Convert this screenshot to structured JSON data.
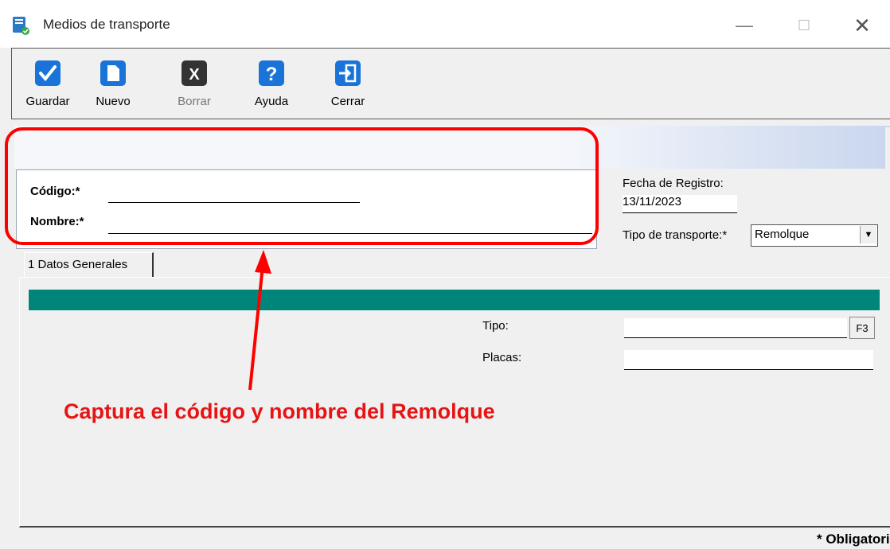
{
  "window": {
    "title": "Medios de transporte",
    "controls": {
      "minimize": "—",
      "maximize": "☐",
      "close": "✕"
    }
  },
  "toolbar": {
    "buttons": [
      {
        "label": "Guardar",
        "icon": "check-icon",
        "enabled": true
      },
      {
        "label": "Nuevo",
        "icon": "new-document-icon",
        "enabled": true
      },
      {
        "label": "Borrar",
        "icon": "delete-x-icon",
        "enabled": false
      },
      {
        "label": "Ayuda",
        "icon": "help-icon",
        "enabled": true
      },
      {
        "label": "Cerrar",
        "icon": "exit-door-icon",
        "enabled": true
      }
    ]
  },
  "form": {
    "codigo_label": "Código:*",
    "codigo_value": "",
    "nombre_label": "Nombre:*",
    "nombre_value": "",
    "fecha_label": "Fecha de Registro:",
    "fecha_value": "13/11/2023",
    "tipo_transporte_label": "Tipo de transporte:*",
    "tipo_transporte_value": "Remolque"
  },
  "tabs": [
    {
      "label": "1 Datos Generales",
      "active": true
    }
  ],
  "datos_generales": {
    "tipo_label": "Tipo:",
    "tipo_value": "",
    "f3_label": "F3",
    "placas_label": "Placas:",
    "placas_value": ""
  },
  "annotation": {
    "text": "Captura el código y nombre del Remolque"
  },
  "footer": {
    "required_note": "* Obligatorio"
  },
  "colors": {
    "highlight": "#ff0000",
    "teal_bar": "#00857a",
    "toolbar_icon": "#1a73d9",
    "disabled_icon": "#333333"
  }
}
